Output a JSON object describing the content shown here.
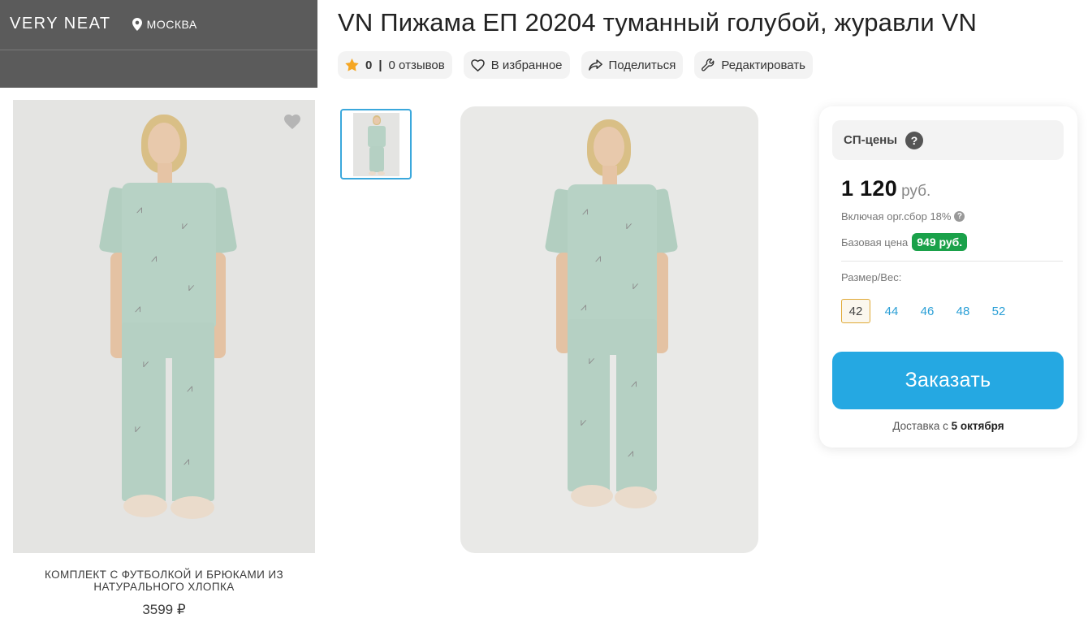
{
  "header": {
    "brand": "VERY NEAT",
    "city": "МОСКВА",
    "city_icon": "map-pin-icon"
  },
  "promo": {
    "caption": "КОМПЛЕКТ С ФУТБОЛКОЙ И БРЮКАМИ ИЗ НАТУРАЛЬНОГО ХЛОПКА",
    "price": "3599 ₽"
  },
  "product": {
    "title": "VN Пижама ЕП 20204 туманный голубой, журавли VN"
  },
  "actions": {
    "rating": "0",
    "separator": "|",
    "reviews": "0 отзывов",
    "favorite": "В избранное",
    "share": "Поделиться",
    "edit": "Редактировать"
  },
  "order_card": {
    "sp_label": "СП-цены",
    "sp_help": "?",
    "price_value": "1 120",
    "price_currency": "руб.",
    "fee_note": "Включая орг.сбор 18%",
    "fee_help": "?",
    "base_price_label": "Базовая цена",
    "base_price_value": "949 руб.",
    "size_label": "Размер/Вес:",
    "sizes": [
      "42",
      "44",
      "46",
      "48",
      "52"
    ],
    "selected_size": "42",
    "order_button": "Заказать",
    "delivery_prefix": "Доставка с",
    "delivery_date": "5 октября"
  },
  "colors": {
    "accent_blue": "#25a8e2",
    "base_price_green": "#1aa14a",
    "star": "#f5a623",
    "brand_bar": "#5b5b5b"
  }
}
